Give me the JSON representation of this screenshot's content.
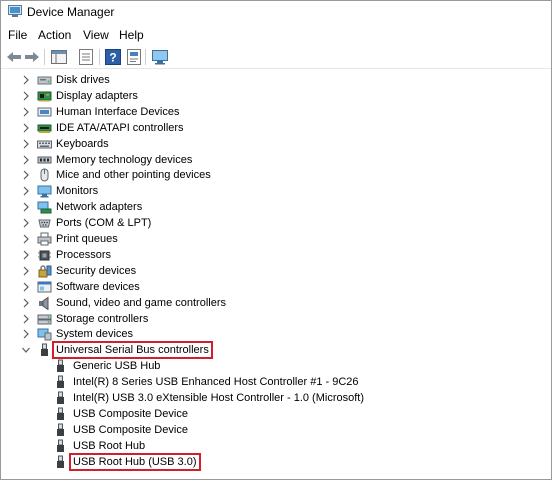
{
  "window": {
    "title": "Device Manager"
  },
  "menu": [
    "File",
    "Action",
    "View",
    "Help"
  ],
  "toolbar": {
    "buttons": [
      "back-icon",
      "forward-icon",
      "console-tree-icon",
      "properties-icon",
      "help-icon",
      "monitor-icon"
    ]
  },
  "tree": {
    "categories": [
      {
        "label": "Disk drives",
        "icon": "disk-drive-icon"
      },
      {
        "label": "Display adapters",
        "icon": "display-adapter-icon"
      },
      {
        "label": "Human Interface Devices",
        "icon": "hid-icon"
      },
      {
        "label": "IDE ATA/ATAPI controllers",
        "icon": "ide-controller-icon"
      },
      {
        "label": "Keyboards",
        "icon": "keyboard-icon"
      },
      {
        "label": "Memory technology devices",
        "icon": "memory-icon"
      },
      {
        "label": "Mice and other pointing devices",
        "icon": "mouse-icon"
      },
      {
        "label": "Monitors",
        "icon": "monitor-icon"
      },
      {
        "label": "Network adapters",
        "icon": "network-adapter-icon"
      },
      {
        "label": "Ports (COM & LPT)",
        "icon": "port-icon"
      },
      {
        "label": "Print queues",
        "icon": "printer-icon"
      },
      {
        "label": "Processors",
        "icon": "processor-icon"
      },
      {
        "label": "Security devices",
        "icon": "security-icon"
      },
      {
        "label": "Software devices",
        "icon": "software-icon"
      },
      {
        "label": "Sound, video and game controllers",
        "icon": "sound-icon"
      },
      {
        "label": "Storage controllers",
        "icon": "storage-icon"
      },
      {
        "label": "System devices",
        "icon": "system-icon"
      }
    ],
    "usb": {
      "label": "Universal Serial Bus controllers",
      "icon": "usb-icon",
      "children": [
        "Generic USB Hub",
        "Intel(R) 8 Series USB Enhanced Host Controller #1 - 9C26",
        "Intel(R) USB 3.0 eXtensible Host Controller - 1.0 (Microsoft)",
        "USB Composite Device",
        "USB Composite Device",
        "USB Root Hub",
        "USB Root Hub (USB 3.0)"
      ]
    }
  },
  "highlight_color": "#d21f2b"
}
